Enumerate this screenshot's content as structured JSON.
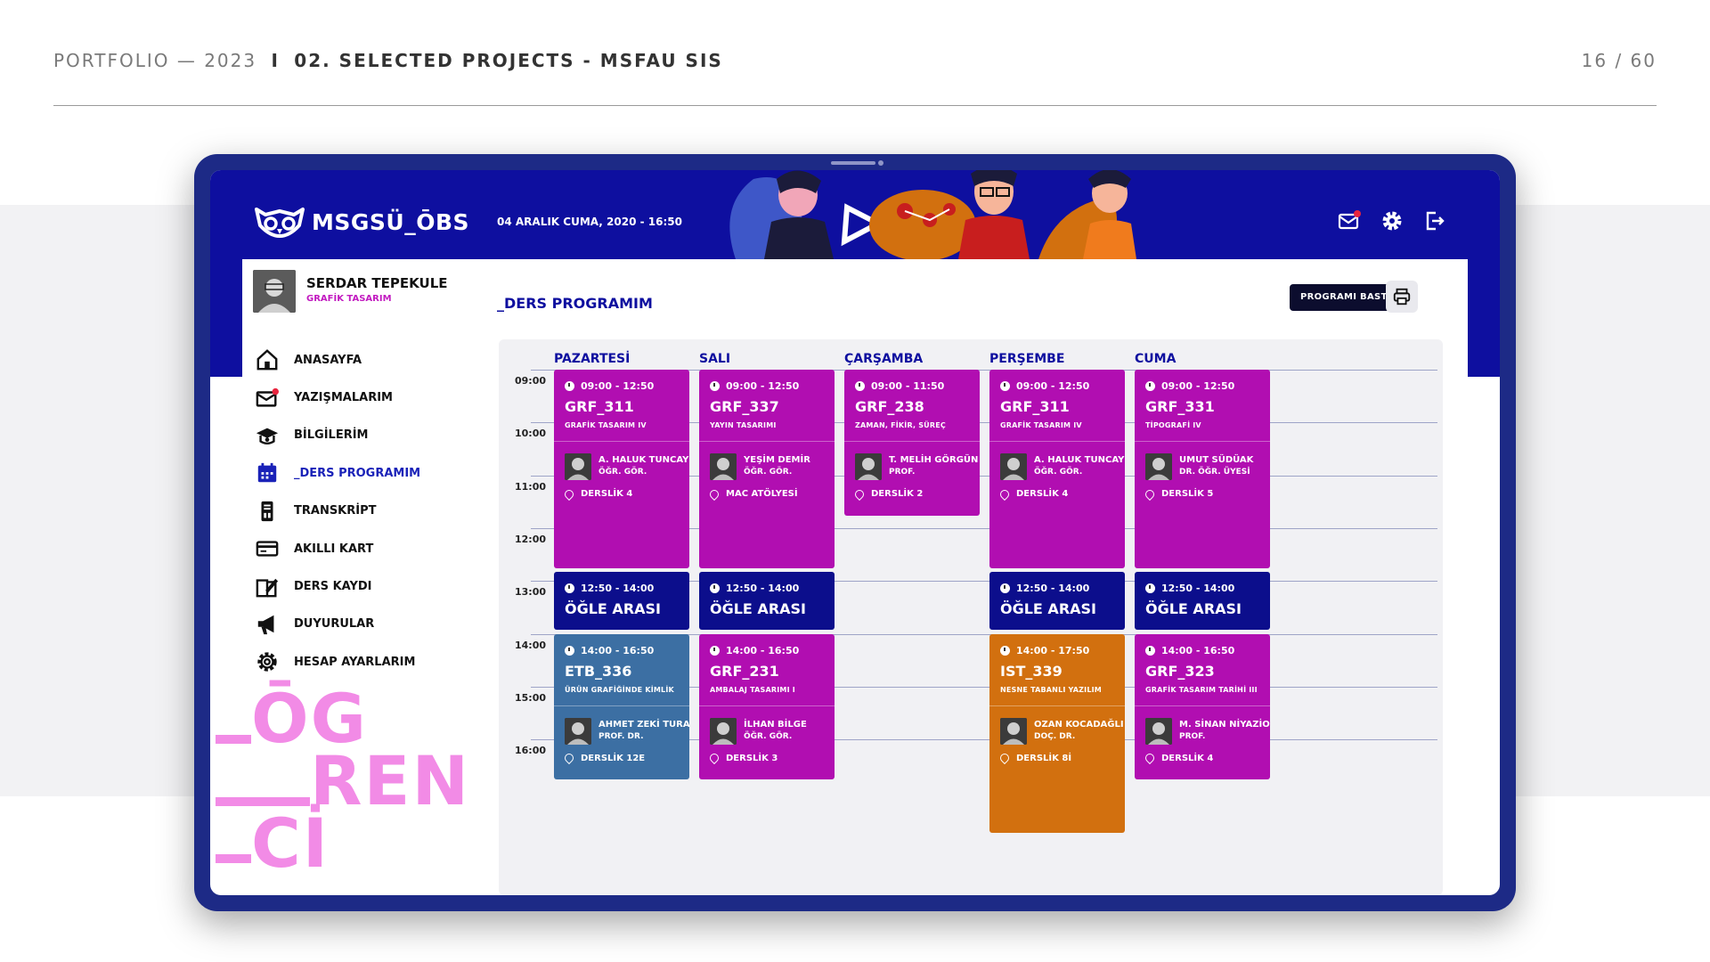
{
  "slide": {
    "header_left": "PORTFOLIO — 2023",
    "separator": "I",
    "header_title": "02. SELECTED PROJECTS - MSFAU SIS",
    "page_counter": "16 / 60"
  },
  "app": {
    "logo_text": "MSGSÜ_ŌBS",
    "datetime": "04 ARALIK CUMA, 2020 - 16:50",
    "top_icons": [
      "mail-icon",
      "gear-icon",
      "logout-icon"
    ]
  },
  "profile": {
    "name": "SERDAR TEPEKULE",
    "department": "GRAFİK TASARIM"
  },
  "menu": [
    {
      "label": "ANASAYFA",
      "icon": "home-icon"
    },
    {
      "label": "YAZIŞMALARIM",
      "icon": "mail-icon"
    },
    {
      "label": "BİLGİLERİM",
      "icon": "graduation-cap-icon"
    },
    {
      "label": "_DERS PROGRAMIM",
      "icon": "calendar-icon",
      "active": true
    },
    {
      "label": "TRANSKRİPT",
      "icon": "transcript-icon"
    },
    {
      "label": "AKILLI KART",
      "icon": "card-icon"
    },
    {
      "label": "DERS KAYDI",
      "icon": "course-register-icon"
    },
    {
      "label": "DUYURULAR",
      "icon": "megaphone-icon"
    },
    {
      "label": "HESAP AYARLARIM",
      "icon": "settings-icon"
    }
  ],
  "decor": {
    "line1": "ŌG",
    "line2": "REN",
    "line3": "Cİ"
  },
  "page": {
    "title": "_DERS PROGRAMIM",
    "print_label": "PROGRAMI BASTIR"
  },
  "schedule": {
    "days": [
      "PAZARTESİ",
      "SALI",
      "ÇARŞAMBA",
      "PERŞEMBE",
      "CUMA"
    ],
    "hours": [
      "09:00",
      "10:00",
      "11:00",
      "12:00",
      "13:00",
      "14:00",
      "15:00",
      "16:00"
    ],
    "blocks": [
      {
        "day": 0,
        "start": 9,
        "end": 12.83,
        "color": "magenta",
        "time": "09:00 - 12:50",
        "code": "GRF_311",
        "name": "GRAFİK TASARIM IV",
        "teacher": "A. HALUK TUNCAY",
        "title": "ÖĞR. GÖR.",
        "room": "DERSLİK 4"
      },
      {
        "day": 1,
        "start": 9,
        "end": 12.83,
        "color": "magenta",
        "time": "09:00 - 12:50",
        "code": "GRF_337",
        "name": "YAYIN TASARIMI",
        "teacher": "YEŞİM DEMİR",
        "title": "ÖĞR. GÖR.",
        "room": "MAC ATÖLYESİ"
      },
      {
        "day": 2,
        "start": 9,
        "end": 11.83,
        "color": "magenta",
        "time": "09:00 - 11:50",
        "code": "GRF_238",
        "name": "ZAMAN, FİKİR, SÜREÇ",
        "teacher": "T. MELİH GÖRGÜN",
        "title": "PROF.",
        "room": "DERSLİK 2"
      },
      {
        "day": 3,
        "start": 9,
        "end": 12.83,
        "color": "magenta",
        "time": "09:00 - 12:50",
        "code": "GRF_311",
        "name": "GRAFİK TASARIM IV",
        "teacher": "A. HALUK TUNCAY",
        "title": "ÖĞR. GÖR.",
        "room": "DERSLİK 4"
      },
      {
        "day": 4,
        "start": 9,
        "end": 12.83,
        "color": "magenta",
        "time": "09:00 - 12:50",
        "code": "GRF_331",
        "name": "TİPOGRAFİ IV",
        "teacher": "UMUT SÜDÜAK",
        "title": "DR. ÖĞR. ÜYESİ",
        "room": "DERSLİK 5"
      },
      {
        "day": 0,
        "start": 12.83,
        "end": 14,
        "color": "navy",
        "time": "12:50 - 14:00",
        "code": "ÖĞLE ARASI",
        "lunch": true
      },
      {
        "day": 1,
        "start": 12.83,
        "end": 14,
        "color": "navy",
        "time": "12:50 - 14:00",
        "code": "ÖĞLE ARASI",
        "lunch": true
      },
      {
        "day": 3,
        "start": 12.83,
        "end": 14,
        "color": "navy",
        "time": "12:50 - 14:00",
        "code": "ÖĞLE ARASI",
        "lunch": true
      },
      {
        "day": 4,
        "start": 12.83,
        "end": 14,
        "color": "navy",
        "time": "12:50 - 14:00",
        "code": "ÖĞLE ARASI",
        "lunch": true
      },
      {
        "day": 0,
        "start": 14,
        "end": 16.83,
        "color": "steel",
        "time": "14:00 - 16:50",
        "code": "ETB_336",
        "name": "ÜRÜN GRAFİĞİNDE KİMLİK",
        "teacher": "AHMET ZEKİ TURAN",
        "title": "PROF. DR.",
        "room": "DERSLİK 12E"
      },
      {
        "day": 1,
        "start": 14,
        "end": 16.83,
        "color": "magenta",
        "time": "14:00 - 16:50",
        "code": "GRF_231",
        "name": "AMBALAJ TASARIMI I",
        "teacher": "İLHAN BİLGE",
        "title": "ÖĞR. GÖR.",
        "room": "DERSLİK 3"
      },
      {
        "day": 3,
        "start": 14,
        "end": 17.83,
        "color": "orange",
        "time": "14:00 - 17:50",
        "code": "IST_339",
        "name": "NESNE TABANLI YAZILIM",
        "teacher": "OZAN KOCADAĞLI",
        "title": "DOÇ. DR.",
        "room": "DERSLİK 8İ"
      },
      {
        "day": 4,
        "start": 14,
        "end": 16.83,
        "color": "magenta",
        "time": "14:00 - 16:50",
        "code": "GRF_323",
        "name": "GRAFİK TASARIM TARİHİ III",
        "teacher": "M. SİNAN NİYAZİOĞLU",
        "title": "PROF.",
        "room": "DERSLİK 4"
      }
    ]
  }
}
